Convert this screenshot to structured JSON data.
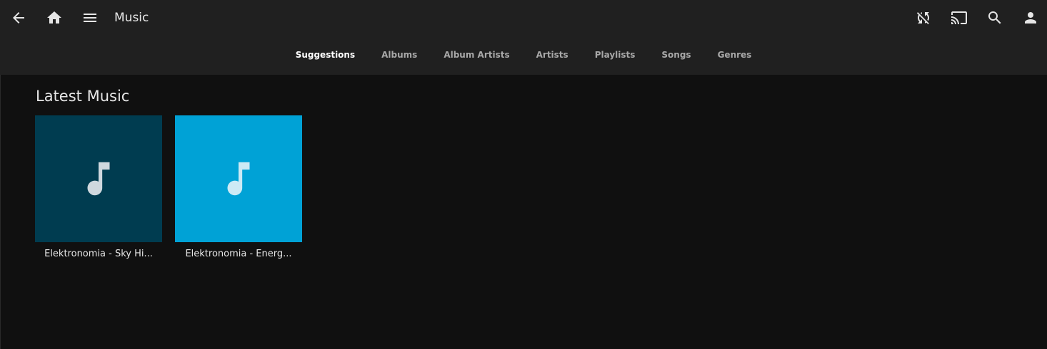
{
  "header": {
    "title": "Music",
    "icons": {
      "back": "arrow-left-icon",
      "home": "home-icon",
      "menu": "menu-icon",
      "sync": "sync-disabled-icon",
      "cast": "cast-icon",
      "search": "search-icon",
      "user": "user-icon"
    }
  },
  "tabs": [
    {
      "label": "Suggestions",
      "active": true
    },
    {
      "label": "Albums",
      "active": false
    },
    {
      "label": "Album Artists",
      "active": false
    },
    {
      "label": "Artists",
      "active": false
    },
    {
      "label": "Playlists",
      "active": false
    },
    {
      "label": "Songs",
      "active": false
    },
    {
      "label": "Genres",
      "active": false
    }
  ],
  "latest": {
    "title": "Latest Music",
    "items": [
      {
        "caption": "Elektronomia - Sky Hi...",
        "color": "#003c50",
        "icon": "music-note-icon"
      },
      {
        "caption": "Elektronomia - Energ...",
        "color": "#00a2d6",
        "icon": "music-note-icon"
      }
    ]
  },
  "colors": {
    "header_bg": "#202020",
    "page_bg": "#101010"
  }
}
